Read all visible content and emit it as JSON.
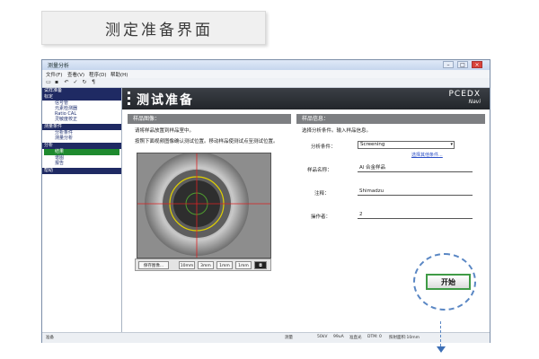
{
  "caption": "测定准备界面",
  "window": {
    "title": "测量分析",
    "controls": {
      "minimize": "–",
      "maximize": "□",
      "close": "×"
    }
  },
  "menu": [
    "文件(F)",
    "查看(V)",
    "程序(D)",
    "帮助(H)"
  ],
  "toolbar_icons": [
    "open-icon",
    "save-icon",
    "undo-icon",
    "check-icon",
    "run-icon",
    "probe-icon"
  ],
  "nav": {
    "sections": [
      {
        "label": "试样准备",
        "items": []
      },
      {
        "label": "标定",
        "items": [
          "信号管",
          "元素检测器",
          "Ratio CAL",
          "灵敏度校正"
        ]
      },
      {
        "label": "测量条件",
        "items": [
          "分析条件",
          "测量分析"
        ]
      },
      {
        "label": "分析",
        "items": [
          "结果",
          "谱图",
          "报告"
        ]
      },
      {
        "label": "帮助",
        "items": []
      }
    ],
    "selected": "结果"
  },
  "header": {
    "title": "测试准备",
    "brand": "PCEDX",
    "brand_sub": "Navi"
  },
  "left_panel": {
    "title": "样品图像：",
    "text1": "请将样品放置到样品室中。",
    "text2": "按照下面视频图像确认测试位置。移动样品使测试点至测试位置。",
    "cam_toolbar": {
      "capture": "保存图像...",
      "buttons": [
        "10mm",
        "3mm",
        "1mm",
        "1mm"
      ]
    }
  },
  "right_panel": {
    "title": "样品信息：",
    "instruction": "选择分析条件。输入样品信息。",
    "fields": {
      "condition_label": "分析条件：",
      "condition_value": "Screening",
      "condition_link": "选择其他条件...",
      "name_label": "样品名称：",
      "name_value": "Al 合金样品",
      "note_label": "注释：",
      "note_value": "Shimadzu",
      "operator_label": "操作者：",
      "operator_value": "2"
    },
    "start_button": "开始"
  },
  "status": {
    "left": "准备",
    "items": [
      "测量",
      "50kV",
      "99uA",
      "准直光",
      "DTM: 0",
      "照射面积:10mm"
    ]
  },
  "colors": {
    "header_dark": "#2a2d32",
    "panel_bar": "#7d7f82",
    "nav_blue": "#1f2a63",
    "nav_green": "#1e8a2e",
    "start_ring": "#5a87c4"
  }
}
